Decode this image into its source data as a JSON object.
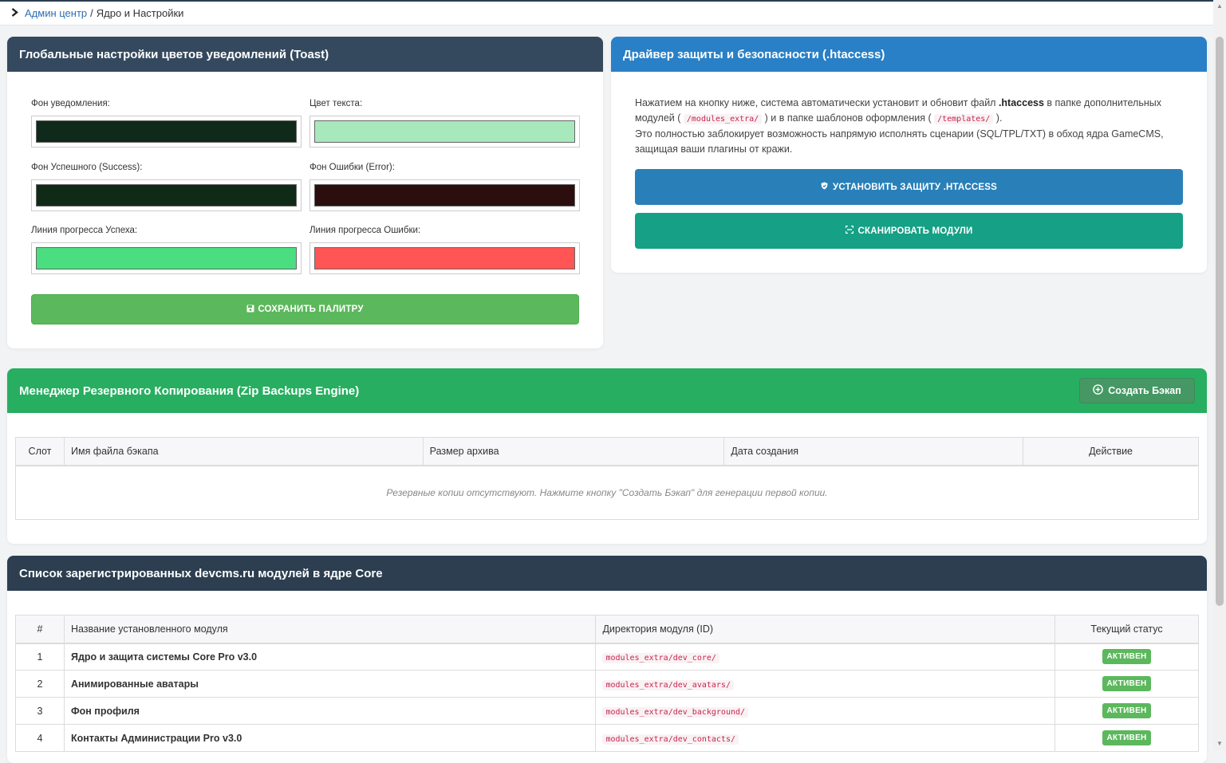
{
  "breadcrumb": {
    "link": "Админ центр",
    "separator": "/",
    "current": "Ядро и Настройки"
  },
  "toast_card": {
    "title": "Глобальные настройки цветов уведомлений (Toast)",
    "fields": [
      {
        "label": "Фон уведомления:",
        "color": "#0f2a1b"
      },
      {
        "label": "Цвет текста:",
        "color": "#a7e8bd"
      },
      {
        "label": "Фон Успешного (Success):",
        "color": "#0f2a17"
      },
      {
        "label": "Фон Ошибки (Error):",
        "color": "#2c0e0e"
      },
      {
        "label": "Линия прогресса Успеха:",
        "color": "#4ade80"
      },
      {
        "label": "Линия прогресса Ошибки:",
        "color": "#ff5555"
      }
    ],
    "save_label": "СОХРАНИТЬ ПАЛИТРУ",
    "save_icon": "floppy-icon"
  },
  "ht_card": {
    "title": "Драйвер защиты и безопасности (.htaccess)",
    "text_1": "Нажатием на кнопку ниже, система автоматически установит и обновит файл ",
    "text_bold": ".htaccess",
    "text_2": " в папке дополнительных модулей ( ",
    "code_1": "/modules_extra/",
    "text_3": " ) и в папке шаблонов оформления ( ",
    "code_2": "/templates/",
    "text_4": " ).",
    "text_5": "Это полностью заблокирует возможность напрямую исполнять сценарии (SQL/TPL/TXT) в обход ядра GameCMS, защищая ваши плагины от кражи.",
    "protect_label": "УСТАНОВИТЬ ЗАЩИТУ .HTACCESS",
    "scan_label": "СКАНИРОВАТЬ МОДУЛИ"
  },
  "backup_card": {
    "title": "Менеджер Резервного Копирования (Zip Backups Engine)",
    "create_label": "Создать Бэкап",
    "columns": [
      "Слот",
      "Имя файла бэкапа",
      "Размер архива",
      "Дата создания",
      "Действие"
    ],
    "empty_text": "Резервные копии отсутствуют. Нажмите кнопку \"Создать Бэкап\" для генерации первой копии."
  },
  "modules_card": {
    "title": "Список зарегистрированных devcms.ru модулей в ядре Core",
    "columns": [
      "#",
      "Название установленного модуля",
      "Директория модуля (ID)",
      "Текущий статус"
    ],
    "rows": [
      {
        "num": "1",
        "name": "Ядро и защита системы Core Pro v3.0",
        "dir": "modules_extra/dev_core/",
        "status": "АКТИВЕН"
      },
      {
        "num": "2",
        "name": "Анимированные аватары",
        "dir": "modules_extra/dev_avatars/",
        "status": "АКТИВЕН"
      },
      {
        "num": "3",
        "name": "Фон профиля",
        "dir": "modules_extra/dev_background/",
        "status": "АКТИВЕН"
      },
      {
        "num": "4",
        "name": "Контакты Администрации Pro v3.0",
        "dir": "modules_extra/dev_contacts/",
        "status": "АКТИВЕН"
      }
    ]
  }
}
